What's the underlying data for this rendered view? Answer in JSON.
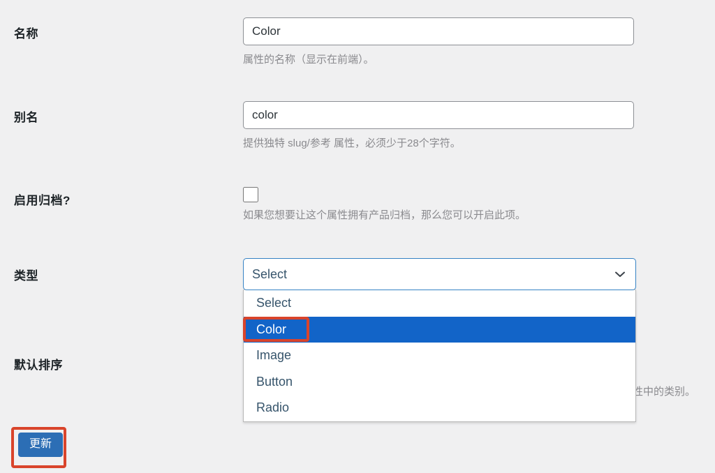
{
  "form": {
    "rows": [
      {
        "label": "名称",
        "value": "Color",
        "help": "属性的名称（显示在前端）。"
      },
      {
        "label": "别名",
        "value": "color",
        "help": "提供独特 slug/参考 属性，必须少于28个字符。"
      },
      {
        "label": "启用归档?",
        "checked": false,
        "help": "如果您想要让这个属性拥有产品归档，那么您可以开启此项。"
      },
      {
        "label": "类型",
        "selected_value": "Select"
      },
      {
        "label": "默认排序",
        "help_fragment": "性中的类别。"
      }
    ]
  },
  "type_select": {
    "selected_value": "Select",
    "chevron_icon": "chevron-down-icon",
    "options": [
      {
        "label": "Select",
        "highlighted": false
      },
      {
        "label": "Color",
        "highlighted": true
      },
      {
        "label": "Image",
        "highlighted": false
      },
      {
        "label": "Button",
        "highlighted": false
      },
      {
        "label": "Radio",
        "highlighted": false
      }
    ]
  },
  "actions": {
    "update_label": "更新"
  },
  "annotations": {
    "color_option_box": "red-highlight-box",
    "update_button_box": "red-highlight-box"
  },
  "colors": {
    "background": "#f0f0f1",
    "accent_blue": "#2c6eb5",
    "select_border_blue": "#3582c4",
    "option_highlight_blue": "#1264c8",
    "annotation_red": "#d9442b",
    "help_text_gray": "#8a8a8e",
    "label_dark": "#1d2327"
  }
}
